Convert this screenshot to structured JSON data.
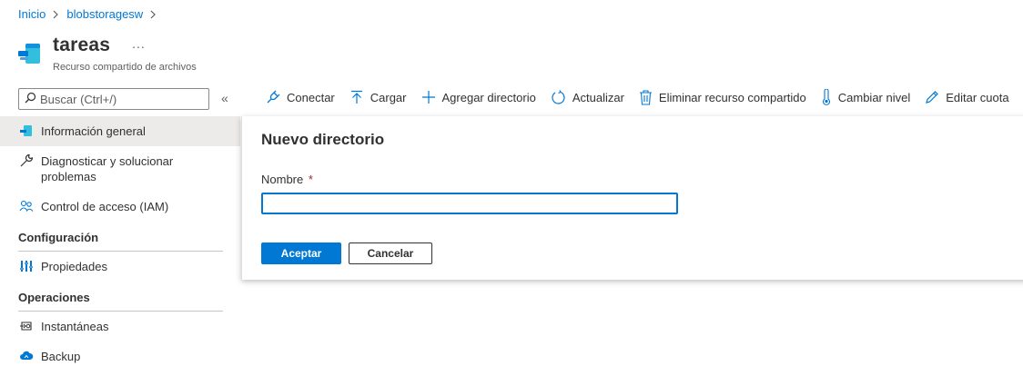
{
  "breadcrumb": {
    "items": [
      "Inicio",
      "blobstoragesw"
    ]
  },
  "header": {
    "title": "tareas",
    "more": "...",
    "subtitle": "Recurso compartido de archivos"
  },
  "search": {
    "placeholder": "Buscar (Ctrl+/)",
    "collapse": "«"
  },
  "sidebar": {
    "items": [
      {
        "label": "Información general",
        "icon": "file-share-icon"
      },
      {
        "label": "Diagnosticar y solucionar problemas",
        "icon": "wrench-icon"
      },
      {
        "label": "Control de acceso (IAM)",
        "icon": "people-icon"
      }
    ],
    "sections": [
      {
        "title": "Configuración",
        "items": [
          {
            "label": "Propiedades",
            "icon": "properties-icon"
          }
        ]
      },
      {
        "title": "Operaciones",
        "items": [
          {
            "label": "Instantáneas",
            "icon": "snapshot-icon"
          },
          {
            "label": "Backup",
            "icon": "backup-cloud-icon"
          }
        ]
      }
    ]
  },
  "toolbar": {
    "connect": "Conectar",
    "upload": "Cargar",
    "add_directory": "Agregar directorio",
    "refresh": "Actualizar",
    "delete_share": "Eliminar recurso compartido",
    "change_tier": "Cambiar nivel",
    "edit_quota": "Editar cuota"
  },
  "dialog": {
    "title": "Nuevo directorio",
    "field_label": "Nombre",
    "required_mark": "*",
    "field_value": "",
    "accept": "Aceptar",
    "cancel": "Cancelar"
  },
  "colors": {
    "accent": "#0078d4",
    "required": "#a4262c",
    "active_bg": "#edebe9"
  }
}
